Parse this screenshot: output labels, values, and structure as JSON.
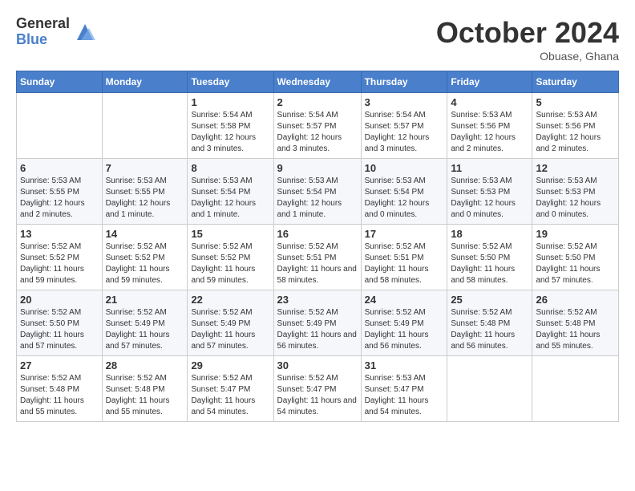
{
  "logo": {
    "general": "General",
    "blue": "Blue"
  },
  "title": "October 2024",
  "location": "Obuase, Ghana",
  "days_of_week": [
    "Sunday",
    "Monday",
    "Tuesday",
    "Wednesday",
    "Thursday",
    "Friday",
    "Saturday"
  ],
  "weeks": [
    [
      {
        "day": "",
        "info": ""
      },
      {
        "day": "",
        "info": ""
      },
      {
        "day": "1",
        "info": "Sunrise: 5:54 AM\nSunset: 5:58 PM\nDaylight: 12 hours and 3 minutes."
      },
      {
        "day": "2",
        "info": "Sunrise: 5:54 AM\nSunset: 5:57 PM\nDaylight: 12 hours and 3 minutes."
      },
      {
        "day": "3",
        "info": "Sunrise: 5:54 AM\nSunset: 5:57 PM\nDaylight: 12 hours and 3 minutes."
      },
      {
        "day": "4",
        "info": "Sunrise: 5:53 AM\nSunset: 5:56 PM\nDaylight: 12 hours and 2 minutes."
      },
      {
        "day": "5",
        "info": "Sunrise: 5:53 AM\nSunset: 5:56 PM\nDaylight: 12 hours and 2 minutes."
      }
    ],
    [
      {
        "day": "6",
        "info": "Sunrise: 5:53 AM\nSunset: 5:55 PM\nDaylight: 12 hours and 2 minutes."
      },
      {
        "day": "7",
        "info": "Sunrise: 5:53 AM\nSunset: 5:55 PM\nDaylight: 12 hours and 1 minute."
      },
      {
        "day": "8",
        "info": "Sunrise: 5:53 AM\nSunset: 5:54 PM\nDaylight: 12 hours and 1 minute."
      },
      {
        "day": "9",
        "info": "Sunrise: 5:53 AM\nSunset: 5:54 PM\nDaylight: 12 hours and 1 minute."
      },
      {
        "day": "10",
        "info": "Sunrise: 5:53 AM\nSunset: 5:54 PM\nDaylight: 12 hours and 0 minutes."
      },
      {
        "day": "11",
        "info": "Sunrise: 5:53 AM\nSunset: 5:53 PM\nDaylight: 12 hours and 0 minutes."
      },
      {
        "day": "12",
        "info": "Sunrise: 5:53 AM\nSunset: 5:53 PM\nDaylight: 12 hours and 0 minutes."
      }
    ],
    [
      {
        "day": "13",
        "info": "Sunrise: 5:52 AM\nSunset: 5:52 PM\nDaylight: 11 hours and 59 minutes."
      },
      {
        "day": "14",
        "info": "Sunrise: 5:52 AM\nSunset: 5:52 PM\nDaylight: 11 hours and 59 minutes."
      },
      {
        "day": "15",
        "info": "Sunrise: 5:52 AM\nSunset: 5:52 PM\nDaylight: 11 hours and 59 minutes."
      },
      {
        "day": "16",
        "info": "Sunrise: 5:52 AM\nSunset: 5:51 PM\nDaylight: 11 hours and 58 minutes."
      },
      {
        "day": "17",
        "info": "Sunrise: 5:52 AM\nSunset: 5:51 PM\nDaylight: 11 hours and 58 minutes."
      },
      {
        "day": "18",
        "info": "Sunrise: 5:52 AM\nSunset: 5:50 PM\nDaylight: 11 hours and 58 minutes."
      },
      {
        "day": "19",
        "info": "Sunrise: 5:52 AM\nSunset: 5:50 PM\nDaylight: 11 hours and 57 minutes."
      }
    ],
    [
      {
        "day": "20",
        "info": "Sunrise: 5:52 AM\nSunset: 5:50 PM\nDaylight: 11 hours and 57 minutes."
      },
      {
        "day": "21",
        "info": "Sunrise: 5:52 AM\nSunset: 5:49 PM\nDaylight: 11 hours and 57 minutes."
      },
      {
        "day": "22",
        "info": "Sunrise: 5:52 AM\nSunset: 5:49 PM\nDaylight: 11 hours and 57 minutes."
      },
      {
        "day": "23",
        "info": "Sunrise: 5:52 AM\nSunset: 5:49 PM\nDaylight: 11 hours and 56 minutes."
      },
      {
        "day": "24",
        "info": "Sunrise: 5:52 AM\nSunset: 5:49 PM\nDaylight: 11 hours and 56 minutes."
      },
      {
        "day": "25",
        "info": "Sunrise: 5:52 AM\nSunset: 5:48 PM\nDaylight: 11 hours and 56 minutes."
      },
      {
        "day": "26",
        "info": "Sunrise: 5:52 AM\nSunset: 5:48 PM\nDaylight: 11 hours and 55 minutes."
      }
    ],
    [
      {
        "day": "27",
        "info": "Sunrise: 5:52 AM\nSunset: 5:48 PM\nDaylight: 11 hours and 55 minutes."
      },
      {
        "day": "28",
        "info": "Sunrise: 5:52 AM\nSunset: 5:48 PM\nDaylight: 11 hours and 55 minutes."
      },
      {
        "day": "29",
        "info": "Sunrise: 5:52 AM\nSunset: 5:47 PM\nDaylight: 11 hours and 54 minutes."
      },
      {
        "day": "30",
        "info": "Sunrise: 5:52 AM\nSunset: 5:47 PM\nDaylight: 11 hours and 54 minutes."
      },
      {
        "day": "31",
        "info": "Sunrise: 5:53 AM\nSunset: 5:47 PM\nDaylight: 11 hours and 54 minutes."
      },
      {
        "day": "",
        "info": ""
      },
      {
        "day": "",
        "info": ""
      }
    ]
  ]
}
